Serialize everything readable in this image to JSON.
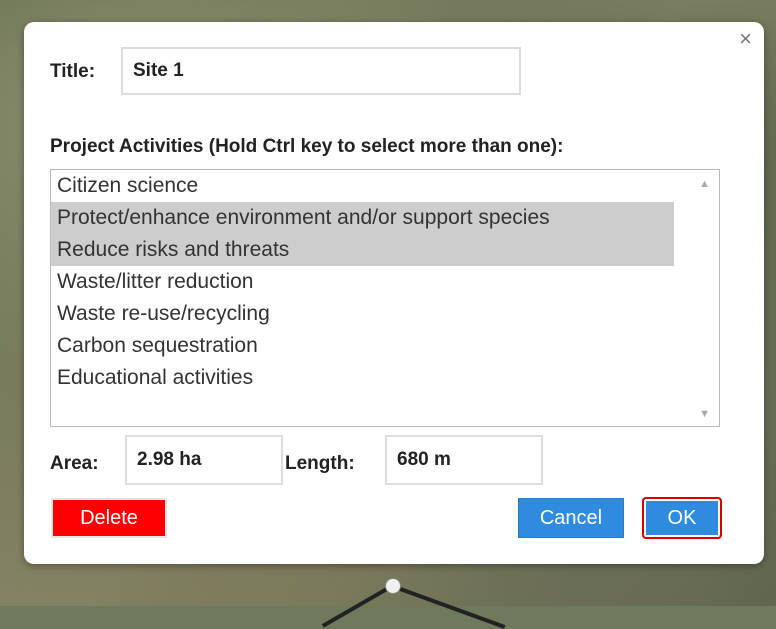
{
  "dialog": {
    "close_glyph": "×",
    "title_label": "Title:",
    "title_value": "Site 1",
    "activities_label": "Project Activities (Hold Ctrl key to select more than one):",
    "activities": [
      {
        "label": "Citizen science",
        "selected": false
      },
      {
        "label": "Protect/enhance environment and/or support species",
        "selected": true
      },
      {
        "label": "Reduce risks and threats",
        "selected": true
      },
      {
        "label": "Waste/litter reduction",
        "selected": false
      },
      {
        "label": "Waste re-use/recycling",
        "selected": false
      },
      {
        "label": "Carbon sequestration",
        "selected": false
      },
      {
        "label": "Educational activities",
        "selected": false
      }
    ],
    "area_label": "Area:",
    "area_value": "2.98 ha",
    "length_label": "Length:",
    "length_value": "680 m",
    "delete_label": "Delete",
    "cancel_label": "Cancel",
    "ok_label": "OK"
  },
  "colors": {
    "delete": "#ff0000",
    "primary": "#2f8be0",
    "selected_option": "#cdcdcd",
    "highlight_border": "#d90000"
  }
}
